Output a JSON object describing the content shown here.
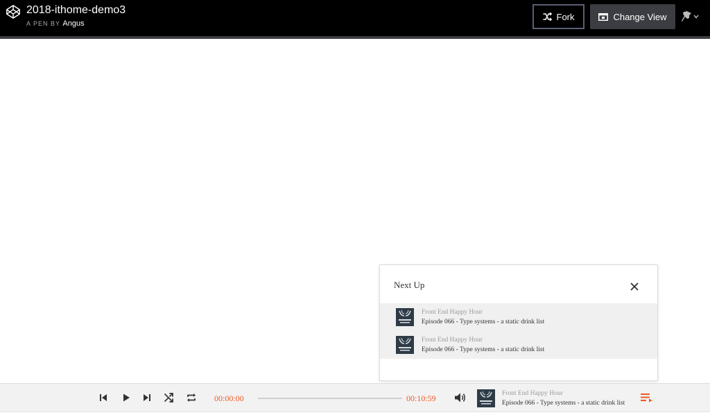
{
  "header": {
    "title": "2018-ithome-demo3",
    "pen_by_label": "A PEN BY",
    "author": "Angus",
    "fork_label": "Fork",
    "change_view_label": "Change View"
  },
  "next_up": {
    "title": "Next Up",
    "items": [
      {
        "show": "Front End Happy Hour",
        "episode": "Episode 066 - Type systems - a static drink list"
      },
      {
        "show": "Front End Happy Hour",
        "episode": "Episode 066 - Type systems - a static drink list"
      }
    ]
  },
  "player": {
    "current_time": "00:00:00",
    "duration": "00:10:59",
    "progress": 0,
    "now_playing": {
      "show": "Front End Happy Hour",
      "episode": "Episode 066 - Type systems - a static drink list"
    }
  },
  "colors": {
    "header_bg": "#000000",
    "accent": "#ee5a24",
    "panel_item_bg": "#f0f0f0",
    "player_bg": "#f2f2f2"
  },
  "icons": {
    "logo": "codepen-logo-icon",
    "fork": "fork-icon",
    "change_view": "change-view-icon",
    "pin": "pin-icon",
    "close": "close-icon",
    "prev": "skip-previous-icon",
    "play": "play-icon",
    "next": "skip-next-icon",
    "shuffle": "shuffle-icon",
    "repeat": "repeat-icon",
    "volume": "volume-icon",
    "queue": "playlist-icon"
  }
}
